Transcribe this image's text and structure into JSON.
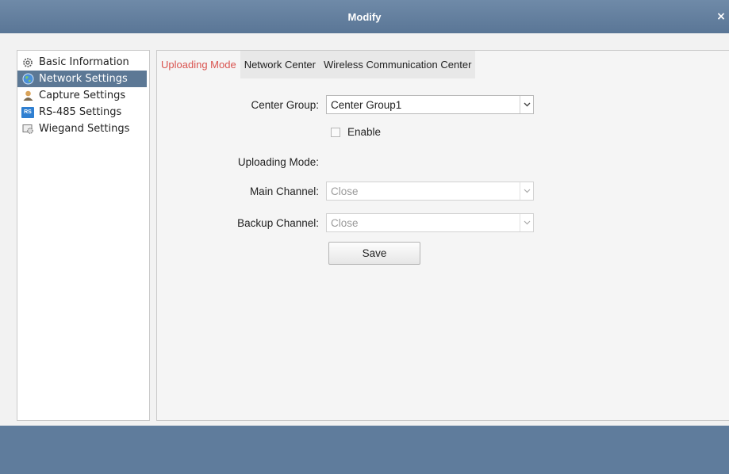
{
  "window": {
    "title": "Modify",
    "close_glyph": "×"
  },
  "sidebar": {
    "items": [
      {
        "label": "Basic Information",
        "icon": "gear-icon",
        "active": false
      },
      {
        "label": "Network Settings",
        "icon": "globe-icon",
        "active": true
      },
      {
        "label": "Capture Settings",
        "icon": "user-icon",
        "active": false
      },
      {
        "label": "RS-485 Settings",
        "icon": "rs-icon",
        "badge": "RS",
        "active": false
      },
      {
        "label": "Wiegand Settings",
        "icon": "card-gear-icon",
        "active": false
      }
    ]
  },
  "tabs": [
    {
      "label": "Uploading Mode",
      "active": true
    },
    {
      "label": "Network Center",
      "active": false
    },
    {
      "label": "Wireless Communication Center",
      "active": false
    }
  ],
  "form": {
    "center_group_label": "Center Group:",
    "center_group_value": "Center Group1",
    "enable_label": "Enable",
    "enable_checked": false,
    "uploading_mode_label": "Uploading Mode:",
    "main_channel_label": "Main Channel:",
    "main_channel_value": "Close",
    "backup_channel_label": "Backup Channel:",
    "backup_channel_value": "Close",
    "save_label": "Save"
  },
  "colors": {
    "titlebar": "#5a7696",
    "active_item": "#5c7895",
    "active_tab_text": "#d9534f",
    "footer": "#5f7c9c"
  }
}
